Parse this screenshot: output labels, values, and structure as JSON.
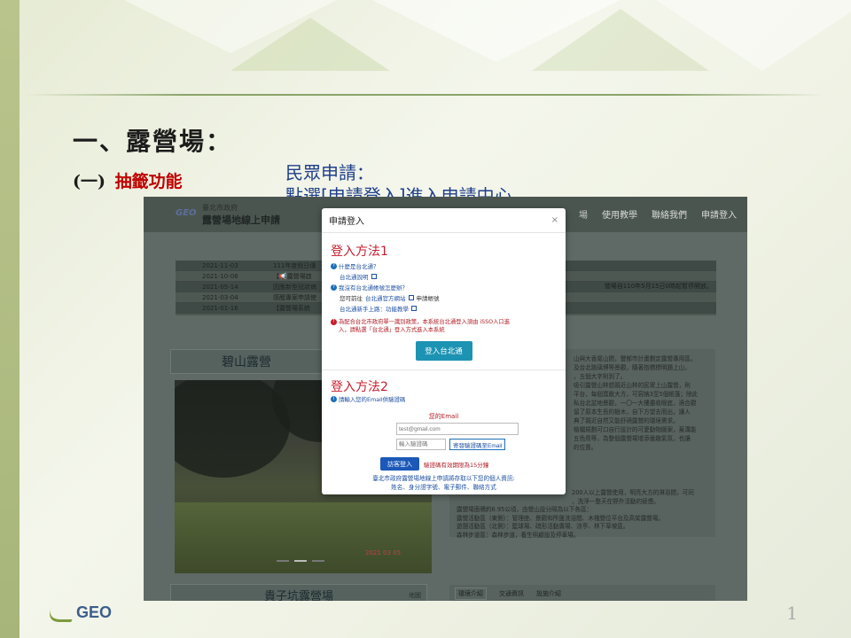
{
  "slide": {
    "title": "一、露營場：",
    "subtitle_num": "(一)",
    "subtitle_text": "抽籤功能",
    "note_line1": "民眾申請：",
    "note_line2": "點選[申請登入]進入申請中心",
    "page_number": "1",
    "footer_logo": "GEO"
  },
  "site": {
    "logo_mark": "GEO",
    "org": "臺北市政府",
    "name": "露營場地線上申請",
    "nav": [
      "場",
      "使用教學",
      "聯絡我們",
      "申請登入"
    ],
    "news": [
      {
        "date": "2021-11-03",
        "text": "111年度假日傳"
      },
      {
        "date": "2021-10-06",
        "text": "【📢露營場啟"
      },
      {
        "date": "2021-05-14",
        "text": "因應新型冠狀病"
      },
      {
        "date": "2021-03-04",
        "text": "感醒專案申請使"
      },
      {
        "date": "2021-01-16",
        "text": "【露營場系統"
      }
    ],
    "news_right": "營場自110年5月15日0時起暫停開放。",
    "camp1": "碧山露營",
    "camp2": "貴子坑露營場",
    "camp2_map": "地圖",
    "photo_date": "2021 03 05",
    "desc_top": [
      "山與大香尾山間，豐郁市計畫劃定露營專用區。",
      "及台北琉璃博等景觀，隨著指標標明題上山，",
      "，五個大字則到了。",
      "吸引露營山林想親近山林的民眾上山露營，則",
      "平台，每個寬敞大方，可容納3至5個帳篷；除此",
      "私台北盆地景觀，一〇一大樓盡收眼底，適合觀",
      "留了原本生長的樹木，自下方望去而出，讓人",
      "典了親近自然又能舒適露營的環境需求。",
      "植檔規劃可口自行設計的可愛動物圖案，蓋溝能",
      "五色鳥等，為整個露營場增添童趣氣氛，也讓",
      "的位置。"
    ],
    "desc_bottom": [
      "200人以上露營使用，明亮大方的淋浴間，可同",
      "，洗淨一整天在野外活動的疲憊。",
      "露營場面積約6.95公頃，由營山設分隔為以下各區：",
      "露營活動區（東側）：管理座、景觀和所盤洗浴間、木棧營位平台及高架露營場。",
      "遊憩活動區（北側）：籃球場、疏形活動廣場、涼亭、林下草坡區。",
      "森林步道區：森林步道，養生照顧設及停車場。"
    ],
    "info_tabs": [
      "環境介紹",
      "交通資訊",
      "設施介紹"
    ]
  },
  "modal": {
    "title": "申請登入",
    "close": "×",
    "method1": "登入方法1",
    "q1": "什麼是台北通？",
    "q1_link": "台北通說明",
    "q2": "我沒有台北通帳號怎麼辦？",
    "q2_prefix": "您可前往",
    "q2_link": "台北通官方網站",
    "q2_suffix": "申請帳號",
    "q3_link": "台北通新手上路：功能教學",
    "notice_line1": "為配合台北市政府單一識別政策，本系統台北通登入須由 iSSO入口進",
    "notice_line2": "入，請點選「台北通」登入方式進入本系統",
    "taipei_btn": "登入台北通",
    "method2": "登入方法2",
    "email_hint": "請輸入您的Email供驗證碼",
    "email_label": "您的Email",
    "email_placeholder": "test@gmail.com",
    "code_placeholder": "輸入驗證碼",
    "send_btn": "寄發驗證碼至Email",
    "guest_btn": "訪客登入",
    "valid_text": "驗證碼有效期限為15分鐘",
    "privacy_line1": "臺北市政府露營場地線上申請將存取以下您的個人資訊:",
    "privacy_line2": "姓名、身分證字號、電子郵件、聯絡方式"
  },
  "colors": {
    "accent_red": "#c00000",
    "note_blue": "#1f3f8a",
    "taipei_btn": "#1d93b3",
    "guest_btn": "#1b58b8"
  }
}
